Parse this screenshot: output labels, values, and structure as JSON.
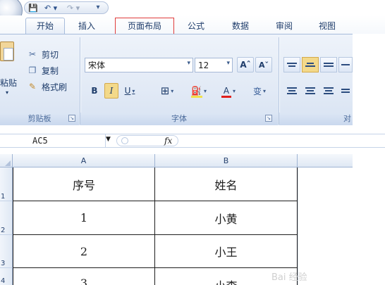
{
  "quick_access": {
    "save": "💾",
    "undo": "↶ ▾",
    "redo": "↷ ▾",
    "more": "▾"
  },
  "tabs": [
    {
      "label": "开始"
    },
    {
      "label": "插入"
    },
    {
      "label": "页面布局"
    },
    {
      "label": "公式"
    },
    {
      "label": "数据"
    },
    {
      "label": "审阅"
    },
    {
      "label": "视图"
    }
  ],
  "clipboard": {
    "paste_label": "粘贴",
    "cut_label": "剪切",
    "copy_label": "复制",
    "painter_label": "格式刷",
    "group_label": "剪贴板",
    "icons": [
      "paste-icon",
      "scissors-icon",
      "copy-icon",
      "format-painter-icon"
    ]
  },
  "font": {
    "name": "宋体",
    "size": "12",
    "grow_label": "Aˆ",
    "shrink_label": "Aˇ",
    "bold_label": "B",
    "italic_label": "I",
    "underline_label": "U",
    "phonetic_label": "变",
    "font_color_label": "A",
    "group_label": "字体",
    "colors": {
      "fill": "#f2e14a",
      "font": "#e0201c"
    }
  },
  "alignment": {
    "group_label_partial": "对"
  },
  "formula_bar": {
    "name_box": "AC5",
    "fx": "fx"
  },
  "sheet": {
    "columns": [
      "A",
      "B"
    ],
    "rows": [
      {
        "num": "1",
        "cells": [
          "序号",
          "姓名"
        ]
      },
      {
        "num": "2",
        "cells": [
          "1",
          "小黄"
        ]
      },
      {
        "num": "3",
        "cells": [
          "2",
          "小王"
        ]
      },
      {
        "num": "4",
        "cells": [
          "3",
          "小李"
        ]
      }
    ]
  },
  "watermark": "Bai 经验"
}
